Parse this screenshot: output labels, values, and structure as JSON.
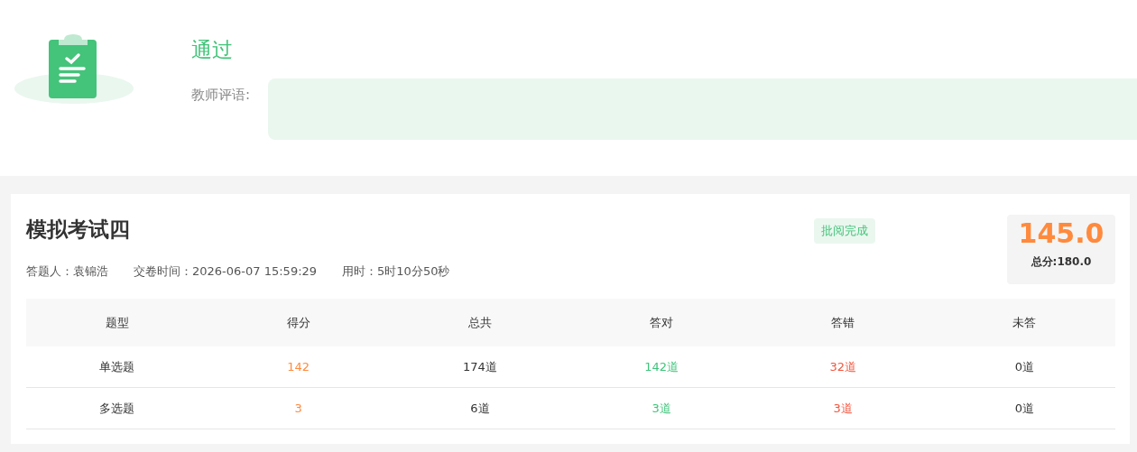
{
  "result": {
    "status": "通过",
    "comment_label": "教师评语:"
  },
  "exam": {
    "title": "模拟考试四",
    "badge": "批阅完成",
    "meta": [
      "答题人：袁锦浩",
      "交卷时间：2026-06-07 15:59:29",
      "用时：5时10分50秒"
    ],
    "score": "145.0",
    "total": "总分:180.0"
  },
  "table": {
    "columns": [
      {
        "label": "题型",
        "kind": "plain"
      },
      {
        "label": "得分",
        "kind": "score"
      },
      {
        "label": "总共",
        "kind": "plain"
      },
      {
        "label": "答对",
        "kind": "correct"
      },
      {
        "label": "答错",
        "kind": "wrong"
      },
      {
        "label": "未答",
        "kind": "plain"
      }
    ],
    "rows": [
      [
        "单选题",
        "142",
        "174道",
        "142道",
        "32道",
        "0道"
      ],
      [
        "多选题",
        "3",
        "6道",
        "3道",
        "3道",
        "0道"
      ]
    ]
  }
}
